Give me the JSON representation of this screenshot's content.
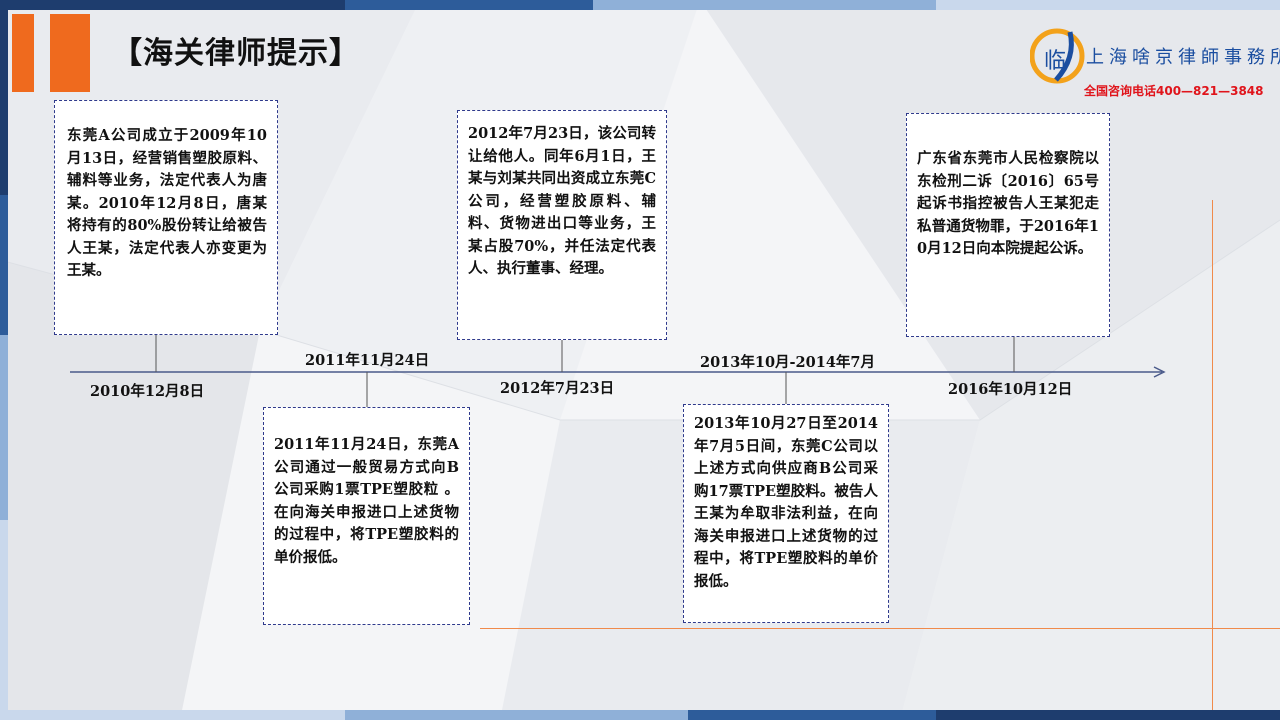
{
  "slide": {
    "title": "【海关律师提示】",
    "logo": {
      "icon_text": "临",
      "firm_name": "上海啥京律師事務所",
      "hotline": "全国咨询电话400—821—3848"
    }
  },
  "colors": {
    "accent_orange": "#ef6a1e",
    "box_border": "#2f3a8c",
    "timeline": "#4a5a8a",
    "hotline_red": "#e0141b",
    "logo_blue": "#1b4ea0"
  },
  "timeline": {
    "events": [
      {
        "date": "2010年12月8日",
        "text": "东莞A公司成立于2009年10月13日，经营销售塑胶原料、辅料等业务，法定代表人为唐某。2010年12月8日，唐某将持有的80%股份转让给被告人王某，法定代表人亦变更为王某。"
      },
      {
        "date": "2011年11月24日",
        "text": "2011年11月24日，东莞A公司通过一般贸易方式向B公司采购1票TPE塑胶粒 。在向海关申报进口上述货物的过程中，将TPE塑胶料的单价报低。"
      },
      {
        "date": "2012年7月23日",
        "text": "2012年7月23日，该公司转让给他人。同年6月1日，王某与刘某共同出资成立东莞C公司，经营塑胶原料、辅料、货物进出口等业务，王某占股70%，并任法定代表人、执行董事、经理。"
      },
      {
        "date": "2013年10月-2014年7月",
        "text": "2013年10月27日至2014年7月5日间，东莞C公司以上述方式向供应商B公司采购17票TPE塑胶料。被告人王某为牟取非法利益，在向海关申报进口上述货物的过程中，将TPE塑胶料的单价报低。"
      },
      {
        "date": "2016年10月12日",
        "text": "广东省东莞市人民检察院以东检刑二诉〔2016〕65号起诉书指控被告人王某犯走私普通货物罪，于2016年10月12日向本院提起公诉。"
      }
    ]
  }
}
